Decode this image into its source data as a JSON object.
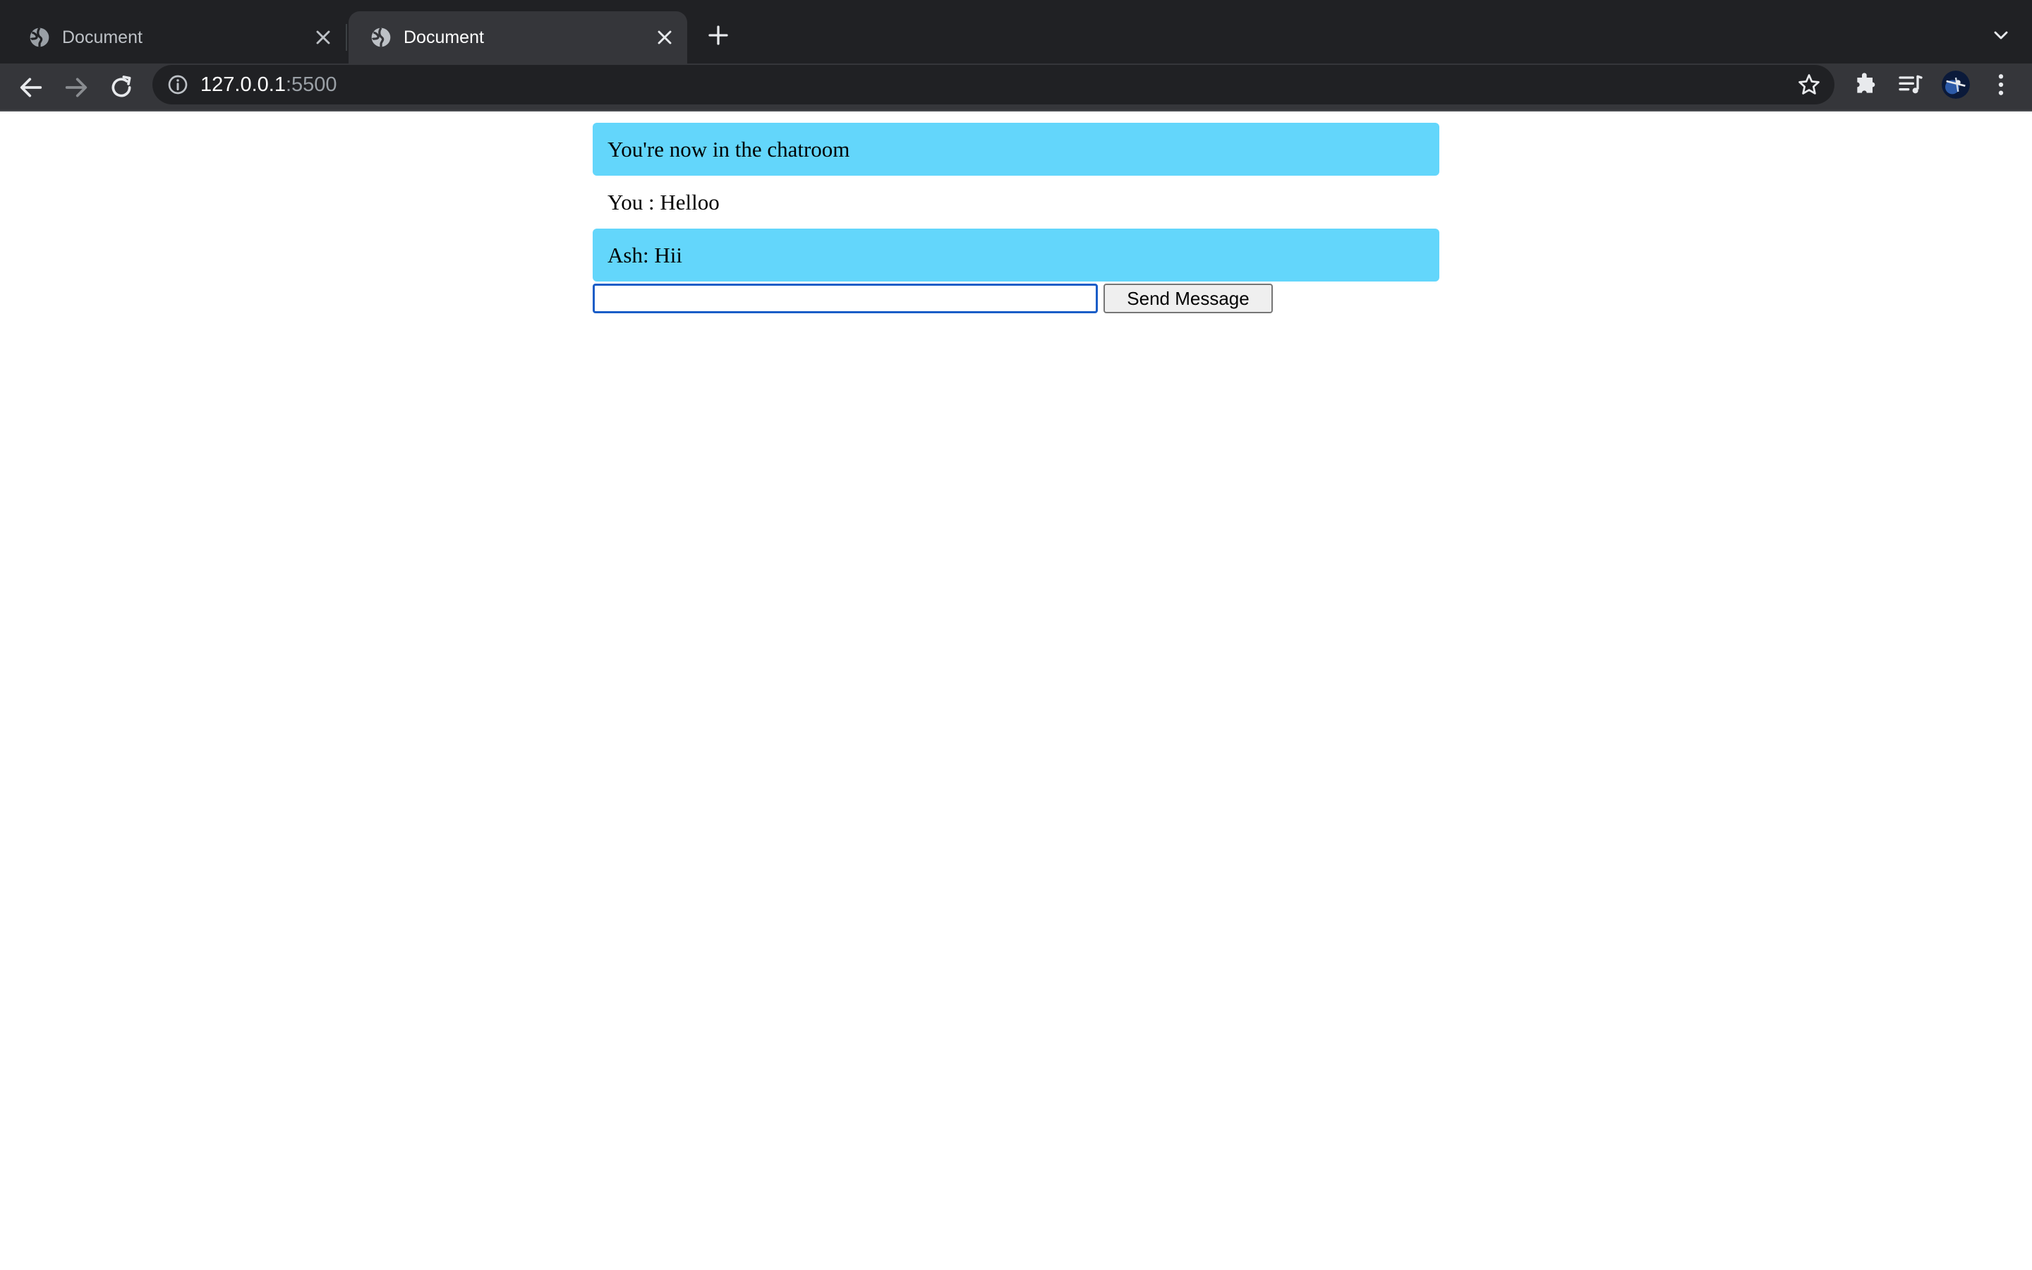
{
  "browser": {
    "tabs": [
      {
        "title": "Document",
        "active": false
      },
      {
        "title": "Document",
        "active": true
      }
    ],
    "url_host": "127.0.0.1",
    "url_port": ":5500",
    "icons": {
      "favicon": "globe-icon",
      "close": "close-icon",
      "new_tab": "plus-icon",
      "tab_search": "chevron-down-icon",
      "back": "arrow-left-icon",
      "forward": "arrow-right-icon",
      "reload": "reload-icon",
      "site_info": "info-icon",
      "bookmark": "star-icon",
      "extensions": "puzzle-icon",
      "media": "media-queue-icon",
      "profile": "avatar",
      "menu": "kebab-menu-icon"
    },
    "colors": {
      "tabstrip": "#202124",
      "toolbar": "#35363a",
      "omnibox": "#202124"
    }
  },
  "chat": {
    "messages": [
      {
        "text": "You're now in the chatroom",
        "highlight": true
      },
      {
        "text": "You : Helloo",
        "highlight": false
      },
      {
        "text": "Ash: Hii",
        "highlight": true
      }
    ],
    "input_value": "",
    "send_label": "Send Message",
    "colors": {
      "highlight": "#63d6fb"
    }
  }
}
